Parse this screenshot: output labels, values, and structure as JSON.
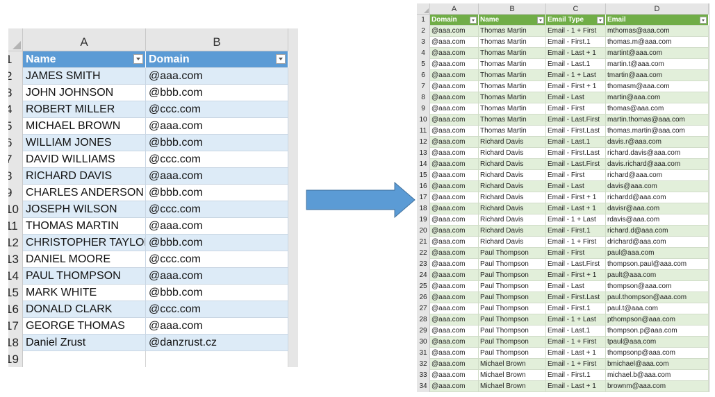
{
  "left_sheet": {
    "column_letters": [
      "A",
      "B"
    ],
    "headers": [
      "Name",
      "Domain"
    ],
    "row_numbers": [
      "1",
      "2",
      "3",
      "4",
      "5",
      "6",
      "7",
      "8",
      "9",
      "10",
      "11",
      "12",
      "13",
      "14",
      "15",
      "16",
      "17",
      "18",
      "19"
    ],
    "rows": [
      [
        "JAMES SMITH",
        "@aaa.com"
      ],
      [
        "JOHN JOHNSON",
        "@bbb.com"
      ],
      [
        "ROBERT MILLER",
        "@ccc.com"
      ],
      [
        "MICHAEL BROWN",
        "@aaa.com"
      ],
      [
        "WILLIAM JONES",
        "@bbb.com"
      ],
      [
        "DAVID WILLIAMS",
        "@ccc.com"
      ],
      [
        "RICHARD DAVIS",
        "@aaa.com"
      ],
      [
        "CHARLES ANDERSON",
        "@bbb.com"
      ],
      [
        "JOSEPH WILSON",
        "@ccc.com"
      ],
      [
        "THOMAS MARTIN",
        "@aaa.com"
      ],
      [
        "CHRISTOPHER TAYLOR",
        "@bbb.com"
      ],
      [
        "DANIEL MOORE",
        "@ccc.com"
      ],
      [
        "PAUL THOMPSON",
        "@aaa.com"
      ],
      [
        "MARK WHITE",
        "@bbb.com"
      ],
      [
        "DONALD CLARK",
        "@ccc.com"
      ],
      [
        "GEORGE THOMAS",
        "@aaa.com"
      ],
      [
        "Daniel Zrust",
        "@danzrust.cz"
      ]
    ],
    "header_color": "#5b9bd5",
    "band_color": "#ddebf7"
  },
  "arrow": {
    "color": "#5b9bd5",
    "icon": "right-arrow-icon"
  },
  "right_sheet": {
    "column_letters": [
      "A",
      "B",
      "C",
      "D"
    ],
    "headers": [
      "Domain",
      "Name",
      "Email Type",
      "Email"
    ],
    "row_numbers": [
      "1",
      "2",
      "3",
      "4",
      "5",
      "6",
      "7",
      "8",
      "9",
      "10",
      "11",
      "12",
      "13",
      "14",
      "15",
      "16",
      "17",
      "18",
      "19",
      "20",
      "21",
      "22",
      "23",
      "24",
      "25",
      "26",
      "27",
      "28",
      "29",
      "30",
      "31",
      "32",
      "33",
      "34"
    ],
    "rows": [
      [
        "@aaa.com",
        "Thomas Martin",
        "Email - 1 + First",
        "mthomas@aaa.com"
      ],
      [
        "@aaa.com",
        "Thomas Martin",
        "Email - First.1",
        "thomas.m@aaa.com"
      ],
      [
        "@aaa.com",
        "Thomas Martin",
        "Email - Last + 1",
        "martint@aaa.com"
      ],
      [
        "@aaa.com",
        "Thomas Martin",
        "Email - Last.1",
        "martin.t@aaa.com"
      ],
      [
        "@aaa.com",
        "Thomas Martin",
        "Email - 1 + Last",
        "tmartin@aaa.com"
      ],
      [
        "@aaa.com",
        "Thomas Martin",
        "Email - First + 1",
        "thomasm@aaa.com"
      ],
      [
        "@aaa.com",
        "Thomas Martin",
        "Email - Last",
        "martin@aaa.com"
      ],
      [
        "@aaa.com",
        "Thomas Martin",
        "Email - First",
        "thomas@aaa.com"
      ],
      [
        "@aaa.com",
        "Thomas Martin",
        "Email - Last.First",
        "martin.thomas@aaa.com"
      ],
      [
        "@aaa.com",
        "Thomas Martin",
        "Email - First.Last",
        "thomas.martin@aaa.com"
      ],
      [
        "@aaa.com",
        "Richard Davis",
        "Email - Last.1",
        "davis.r@aaa.com"
      ],
      [
        "@aaa.com",
        "Richard Davis",
        "Email - First.Last",
        "richard.davis@aaa.com"
      ],
      [
        "@aaa.com",
        "Richard Davis",
        "Email - Last.First",
        "davis.richard@aaa.com"
      ],
      [
        "@aaa.com",
        "Richard Davis",
        "Email - First",
        "richard@aaa.com"
      ],
      [
        "@aaa.com",
        "Richard Davis",
        "Email - Last",
        "davis@aaa.com"
      ],
      [
        "@aaa.com",
        "Richard Davis",
        "Email - First + 1",
        "richardd@aaa.com"
      ],
      [
        "@aaa.com",
        "Richard Davis",
        "Email - Last + 1",
        "davisr@aaa.com"
      ],
      [
        "@aaa.com",
        "Richard Davis",
        "Email - 1 + Last",
        "rdavis@aaa.com"
      ],
      [
        "@aaa.com",
        "Richard Davis",
        "Email - First.1",
        "richard.d@aaa.com"
      ],
      [
        "@aaa.com",
        "Richard Davis",
        "Email - 1 + First",
        "drichard@aaa.com"
      ],
      [
        "@aaa.com",
        "Paul Thompson",
        "Email - First",
        "paul@aaa.com"
      ],
      [
        "@aaa.com",
        "Paul Thompson",
        "Email - Last.First",
        "thompson.paul@aaa.com"
      ],
      [
        "@aaa.com",
        "Paul Thompson",
        "Email - First + 1",
        "pault@aaa.com"
      ],
      [
        "@aaa.com",
        "Paul Thompson",
        "Email - Last",
        "thompson@aaa.com"
      ],
      [
        "@aaa.com",
        "Paul Thompson",
        "Email - First.Last",
        "paul.thompson@aaa.com"
      ],
      [
        "@aaa.com",
        "Paul Thompson",
        "Email - First.1",
        "paul.t@aaa.com"
      ],
      [
        "@aaa.com",
        "Paul Thompson",
        "Email - 1 + Last",
        "pthompson@aaa.com"
      ],
      [
        "@aaa.com",
        "Paul Thompson",
        "Email - Last.1",
        "thompson.p@aaa.com"
      ],
      [
        "@aaa.com",
        "Paul Thompson",
        "Email - 1 + First",
        "tpaul@aaa.com"
      ],
      [
        "@aaa.com",
        "Paul Thompson",
        "Email - Last + 1",
        "thompsonp@aaa.com"
      ],
      [
        "@aaa.com",
        "Michael Brown",
        "Email - 1 + First",
        "bmichael@aaa.com"
      ],
      [
        "@aaa.com",
        "Michael Brown",
        "Email - First.1",
        "michael.b@aaa.com"
      ],
      [
        "@aaa.com",
        "Michael Brown",
        "Email - Last + 1",
        "brownm@aaa.com"
      ]
    ],
    "header_color": "#70ad47",
    "band_color": "#e2efda"
  }
}
